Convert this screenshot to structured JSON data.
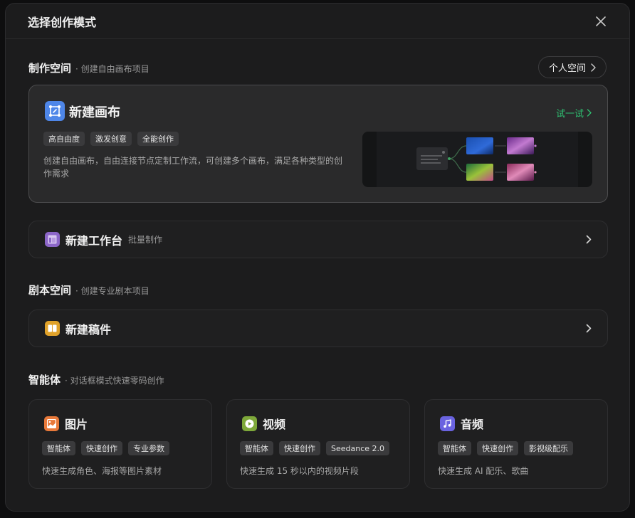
{
  "modal": {
    "title": "选择创作模式"
  },
  "workspace": {
    "title": "制作空间",
    "subtitle": "· 创建自由画布项目",
    "personal_button": "个人空间"
  },
  "canvas_card": {
    "title": "新建画布",
    "try_label": "试一试",
    "tags": [
      "高自由度",
      "激发创意",
      "全能创作"
    ],
    "description": "创建自由画布，自由连接节点定制工作流，可创建多个画布，满足各种类型的创作需求"
  },
  "workbench": {
    "title": "新建工作台",
    "subtitle": "批量制作"
  },
  "script_space": {
    "title": "剧本空间",
    "subtitle": "· 创建专业剧本项目"
  },
  "draft": {
    "title": "新建稿件"
  },
  "agents": {
    "title": "智能体",
    "subtitle": "· 对话框模式快速零码创作",
    "items": [
      {
        "title": "图片",
        "tags": [
          "智能体",
          "快速创作",
          "专业参数"
        ],
        "description": "快速生成角色、海报等图片素材",
        "icon": "image-icon",
        "color": "#e8793a"
      },
      {
        "title": "视频",
        "tags": [
          "智能体",
          "快速创作",
          "Seedance 2.0"
        ],
        "description": "快速生成 15 秒以内的视频片段",
        "icon": "video-play-icon",
        "color": "#7ea83a"
      },
      {
        "title": "音频",
        "tags": [
          "智能体",
          "快速创作",
          "影视级配乐"
        ],
        "description": "快速生成 AI 配乐、歌曲",
        "icon": "music-note-icon",
        "color": "#6a63e0"
      }
    ]
  },
  "colors": {
    "accent_green": "#2fbf71",
    "canvas_icon": "#4e86e8",
    "workbench_icon": "#8c66c8",
    "draft_icon": "#e0a22a"
  }
}
